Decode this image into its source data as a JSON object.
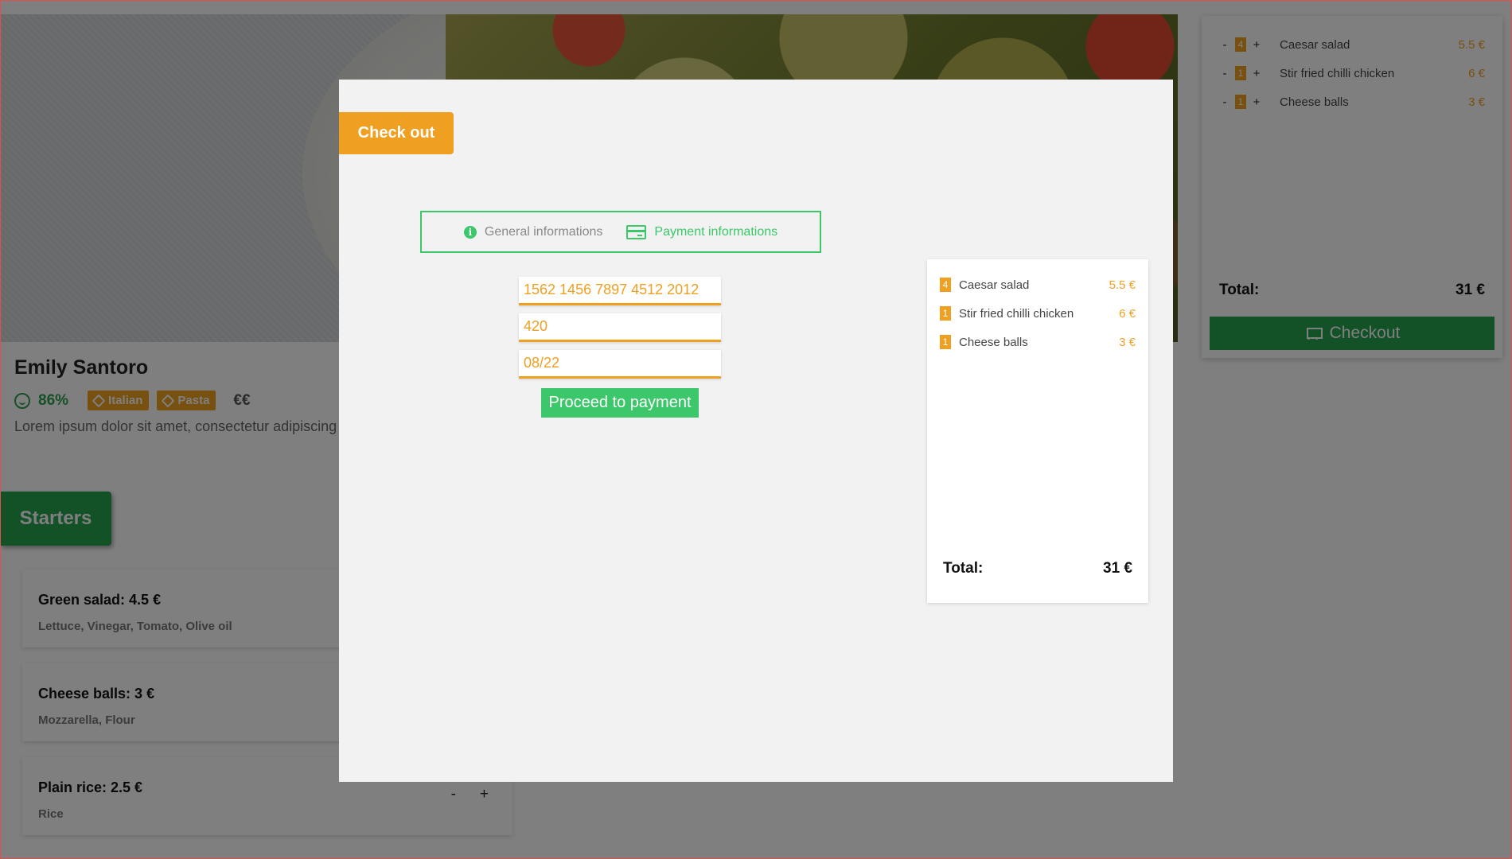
{
  "restaurant": {
    "name": "Emily Santoro",
    "rating": "86%",
    "tags": [
      "Italian",
      "Pasta"
    ],
    "price_level": "€€",
    "description": "Lorem ipsum dolor sit amet, consectetur adipiscing"
  },
  "menu": {
    "section_label": "Starters",
    "dishes": [
      {
        "title": "Green salad: 4.5 €",
        "ingredients": "Lettuce, Vinegar, Tomato, Olive oil"
      },
      {
        "title": "Cheese balls: 3 €",
        "ingredients": "Mozzarella, Flour"
      },
      {
        "title": "Plain rice: 2.5 €",
        "ingredients": "Rice",
        "minus": "-",
        "plus": "+"
      }
    ]
  },
  "side_cart": {
    "items": [
      {
        "minus": "-",
        "qty": "4",
        "plus": "+",
        "name": "Caesar salad",
        "price": "5.5 €"
      },
      {
        "minus": "-",
        "qty": "1",
        "plus": "+",
        "name": "Stir fried chilli chicken",
        "price": "6 €"
      },
      {
        "minus": "-",
        "qty": "1",
        "plus": "+",
        "name": "Cheese balls",
        "price": "3 €"
      }
    ],
    "total_label": "Total:",
    "total_value": "31 €",
    "checkout_label": "Checkout"
  },
  "modal": {
    "title": "Check out",
    "steps": {
      "general": "General informations",
      "payment": "Payment informations",
      "info_icon_glyph": "i"
    },
    "payment": {
      "card_number": "1562 1456 7897 4512 2012",
      "cvv": "420",
      "expiry": "08/22",
      "proceed_label": "Proceed to payment"
    },
    "cart": {
      "items": [
        {
          "qty": "4",
          "name": "Caesar salad",
          "price": "5.5 €"
        },
        {
          "qty": "1",
          "name": "Stir fried chilli chicken",
          "price": "6 €"
        },
        {
          "qty": "1",
          "name": "Cheese balls",
          "price": "3 €"
        }
      ],
      "total_label": "Total:",
      "total_value": "31 €"
    }
  },
  "colors": {
    "accent_orange": "#f0a020",
    "accent_green": "#3cc76a",
    "button_green": "#27a24e"
  },
  "icons": [
    "smile-icon",
    "tag-icon",
    "cart-icon",
    "info-icon",
    "credit-card-icon"
  ]
}
